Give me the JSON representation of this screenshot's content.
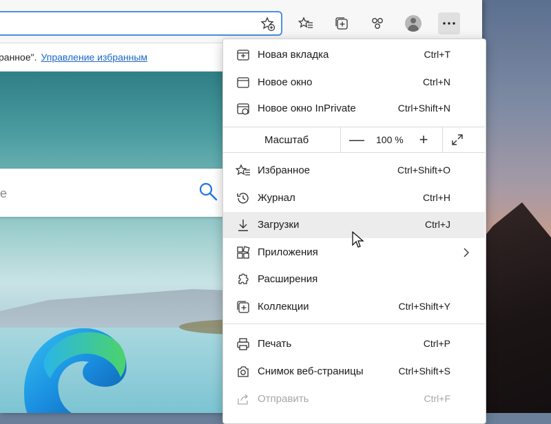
{
  "favorites_bar": {
    "prefix_text": "ранное\".",
    "manage_link": "Управление избранным"
  },
  "search": {
    "placeholder_fragment": "те"
  },
  "menu": {
    "new_tab": {
      "label": "Новая вкладка",
      "shortcut": "Ctrl+T"
    },
    "new_window": {
      "label": "Новое окно",
      "shortcut": "Ctrl+N"
    },
    "new_inprivate": {
      "label": "Новое окно InPrivate",
      "shortcut": "Ctrl+Shift+N"
    },
    "zoom": {
      "label": "Масштаб",
      "value": "100 %",
      "minus": "—",
      "plus": "+"
    },
    "favorites": {
      "label": "Избранное",
      "shortcut": "Ctrl+Shift+O"
    },
    "history": {
      "label": "Журнал",
      "shortcut": "Ctrl+H"
    },
    "downloads": {
      "label": "Загрузки",
      "shortcut": "Ctrl+J"
    },
    "apps": {
      "label": "Приложения"
    },
    "extensions": {
      "label": "Расширения"
    },
    "collections": {
      "label": "Коллекции",
      "shortcut": "Ctrl+Shift+Y"
    },
    "print": {
      "label": "Печать",
      "shortcut": "Ctrl+P"
    },
    "web_capture": {
      "label": "Снимок веб-страницы",
      "shortcut": "Ctrl+Shift+S"
    },
    "share": {
      "label": "Отправить",
      "shortcut": "Ctrl+F"
    }
  },
  "colors": {
    "accent": "#4a8fe0",
    "link": "#1a66c8",
    "hover": "#ececec"
  },
  "icons": [
    "favorite-star-add-icon",
    "favorites-icon",
    "collections-icon",
    "extensions-puzzle-icon",
    "profile-avatar-icon",
    "more-dots-icon",
    "search-icon",
    "edge-logo"
  ]
}
